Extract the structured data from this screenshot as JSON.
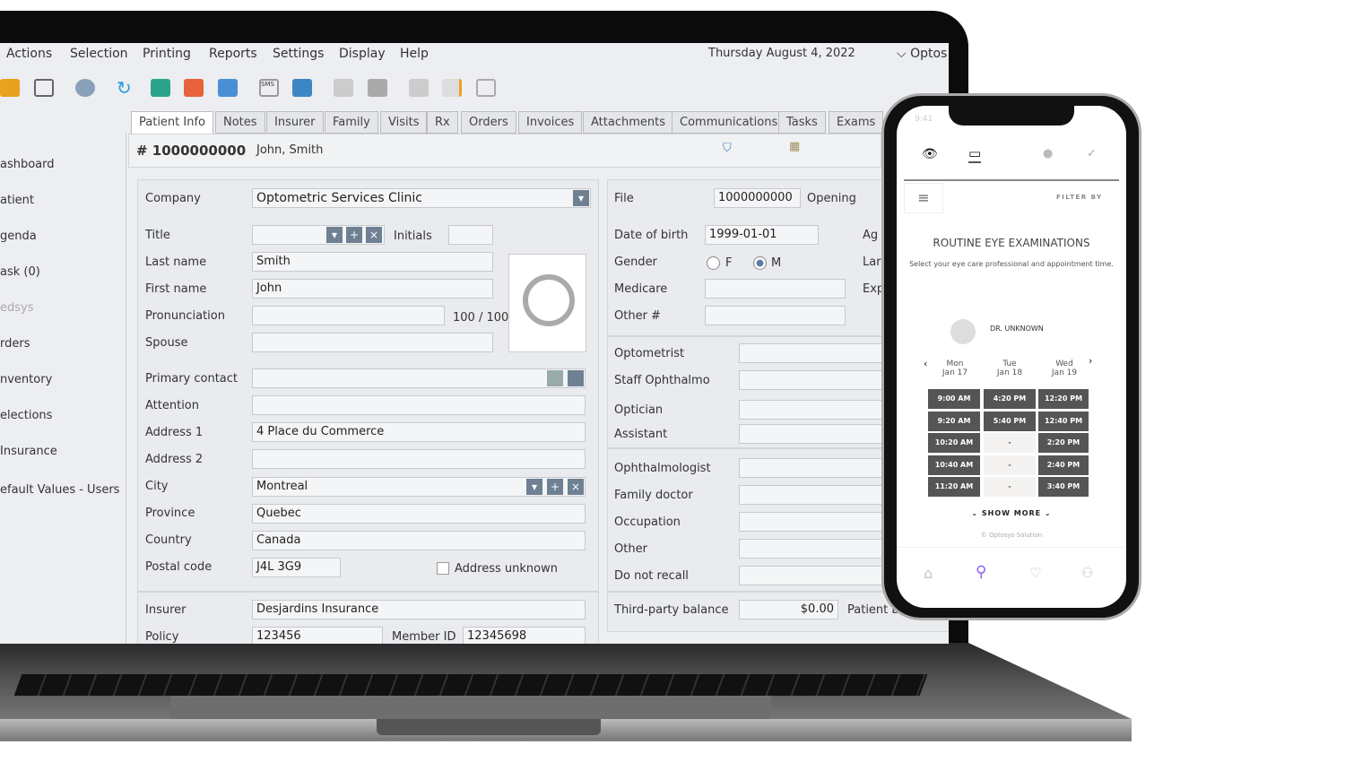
{
  "menu": [
    "Actions",
    "Selection",
    "Printing",
    "Reports",
    "Settings",
    "Display",
    "Help"
  ],
  "date": "Thursday August 4, 2022",
  "account": "Optos",
  "toolbar_icons": [
    "patient-search-icon",
    "contact-card-icon",
    "merge-patients-icon",
    "refresh-icon",
    "print-1-icon",
    "print-2-icon",
    "print-3-icon",
    "sms-icon",
    "email-icon",
    "remove-document-icon",
    "save-icon",
    "add-document-icon",
    "edit-document-icon",
    "trash-icon"
  ],
  "tabs": [
    "Patient Info",
    "Notes",
    "Insurer",
    "Family",
    "Visits",
    "Rx",
    "Orders",
    "Invoices",
    "Attachments",
    "Communications",
    "Tasks",
    "Exams"
  ],
  "sidebar": [
    "ashboard",
    "atient",
    "genda",
    "ask (0)",
    "edsys",
    "rders",
    "nventory",
    "elections",
    "Insurance",
    "efault Values - Users"
  ],
  "patient": {
    "number": "# 1000000000",
    "name": "John, Smith"
  },
  "form": {
    "company_label": "Company",
    "company": "Optometric Services Clinic",
    "title_label": "Title",
    "initials_label": "Initials",
    "last_name_label": "Last name",
    "last_name": "Smith",
    "first_name_label": "First name",
    "first_name": "John",
    "pronunciation_label": "Pronunciation",
    "pron_count": "100 / 100",
    "spouse_label": "Spouse",
    "primary_contact_label": "Primary contact",
    "attention_label": "Attention",
    "address1_label": "Address 1",
    "address1": "4 Place du Commerce",
    "address2_label": "Address 2",
    "city_label": "City",
    "city": "Montreal",
    "province_label": "Province",
    "province": "Quebec",
    "country_label": "Country",
    "country": "Canada",
    "postal_label": "Postal code",
    "postal": "J4L 3G9",
    "address_unknown": "Address unknown",
    "insurer_label": "Insurer",
    "insurer": "Desjardins Insurance",
    "policy_label": "Policy",
    "policy": "123456",
    "member_label": "Member ID",
    "member": "12345698",
    "file_label": "File",
    "file": "1000000000",
    "opening_label": "Opening",
    "dob_label": "Date of birth",
    "dob": "1999-01-01",
    "age_label": "Ag",
    "gender_label": "Gender",
    "gender_f": "F",
    "gender_m": "M",
    "gender_selected": "M",
    "lang_label": "Lar",
    "medicare_label": "Medicare",
    "exp_label": "Exp",
    "other_no_label": "Other #",
    "optometrist_label": "Optometrist",
    "staff_label": "Staff Ophthalmo",
    "optician_label": "Optician",
    "assistant_label": "Assistant",
    "ophthalmologist_label": "Ophthalmologist",
    "family_doctor_label": "Family doctor",
    "occupation_label": "Occupation",
    "other_label": "Other",
    "do_not_recall_label": "Do not recall",
    "third_party_label": "Third-party balance",
    "third_party": "$0.00",
    "patient_balance_label": "Patient b"
  },
  "phone": {
    "time": "9:41",
    "filter": "FILTER BY",
    "title": "ROUTINE EYE EXAMINATIONS",
    "subtitle": "Select your eye care professional and appointment time.",
    "doctor": "DR. UNKNOWN",
    "days": [
      {
        "day": "Mon",
        "date": "Jan 17",
        "slots": [
          "9:00 AM",
          "9:20 AM",
          "10:20 AM",
          "10:40 AM",
          "11:20 AM"
        ]
      },
      {
        "day": "Tue",
        "date": "Jan 18",
        "slots": [
          "4:20 PM",
          "5:40 PM",
          "-",
          "-",
          "-"
        ]
      },
      {
        "day": "Wed",
        "date": "Jan 19",
        "slots": [
          "12:20 PM",
          "12:40 PM",
          "2:20 PM",
          "2:40 PM",
          "3:40 PM"
        ]
      }
    ],
    "show_more": "⌄ SHOW MORE ⌄",
    "footer": "© Optosys Solution",
    "accent": "#8b5cf6"
  }
}
